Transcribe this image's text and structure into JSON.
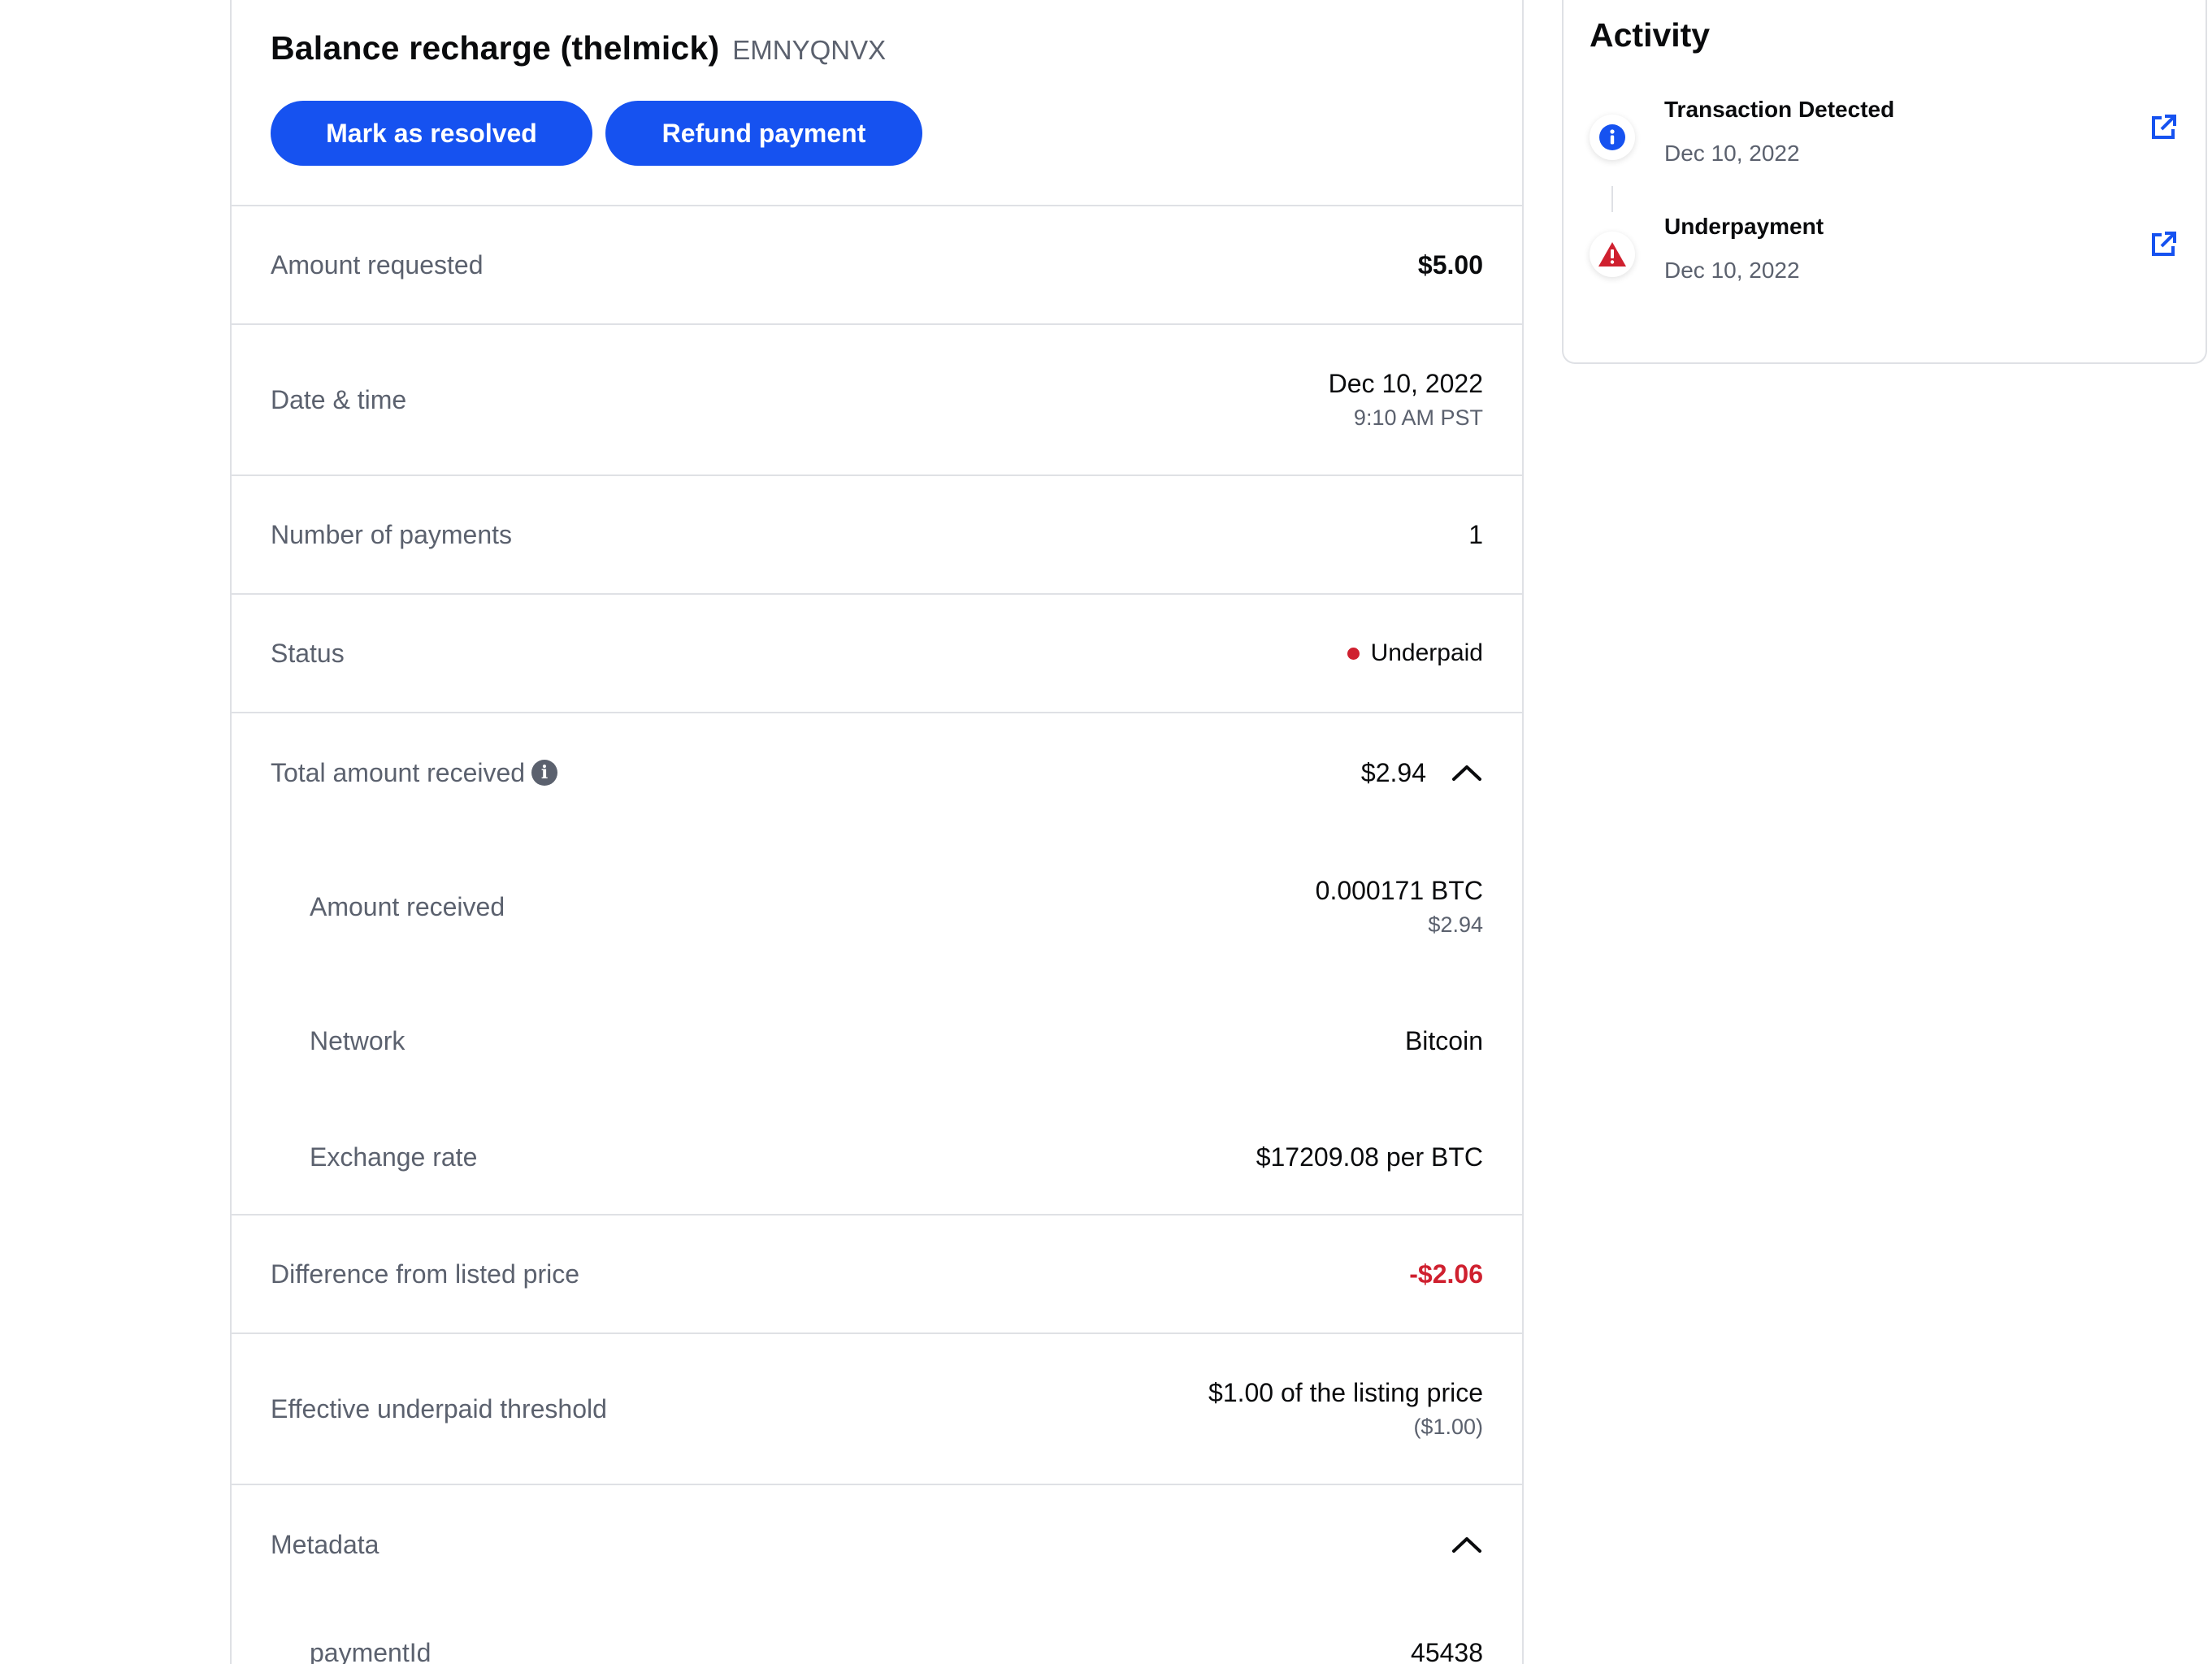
{
  "header": {
    "title": "Balance recharge (thelmick)",
    "code": "EMNYQNVX",
    "buttons": {
      "resolve": "Mark as resolved",
      "refund": "Refund payment"
    }
  },
  "details": {
    "amount_requested": {
      "label": "Amount requested",
      "value": "$5.00"
    },
    "date_time": {
      "label": "Date & time",
      "date": "Dec 10, 2022",
      "time": "9:10 AM PST"
    },
    "num_payments": {
      "label": "Number of payments",
      "value": "1"
    },
    "status": {
      "label": "Status",
      "value": "Underpaid",
      "color": "#cf202f"
    },
    "total_received": {
      "label": "Total amount received",
      "value": "$2.94",
      "items": {
        "amount_received": {
          "label": "Amount received",
          "value": "0.000171 BTC",
          "sub": "$2.94"
        },
        "network": {
          "label": "Network",
          "value": "Bitcoin"
        },
        "exchange_rate": {
          "label": "Exchange rate",
          "value": "$17209.08 per BTC"
        }
      }
    },
    "difference": {
      "label": "Difference from listed price",
      "value": "-$2.06"
    },
    "threshold": {
      "label": "Effective underpaid threshold",
      "value": "$1.00 of the listing price",
      "sub": "($1.00)"
    },
    "metadata": {
      "label": "Metadata",
      "items": [
        {
          "key": "paymentId",
          "value": "45438"
        }
      ]
    }
  },
  "activity": {
    "title": "Activity",
    "events": [
      {
        "name": "Transaction Detected",
        "date": "Dec 10, 2022",
        "icon": "info-icon"
      },
      {
        "name": "Underpayment",
        "date": "Dec 10, 2022",
        "icon": "warning-icon"
      }
    ]
  },
  "colors": {
    "accent": "#1652f0",
    "danger": "#cf202f",
    "muted": "#5b616e",
    "border": "#dfe1e5"
  }
}
